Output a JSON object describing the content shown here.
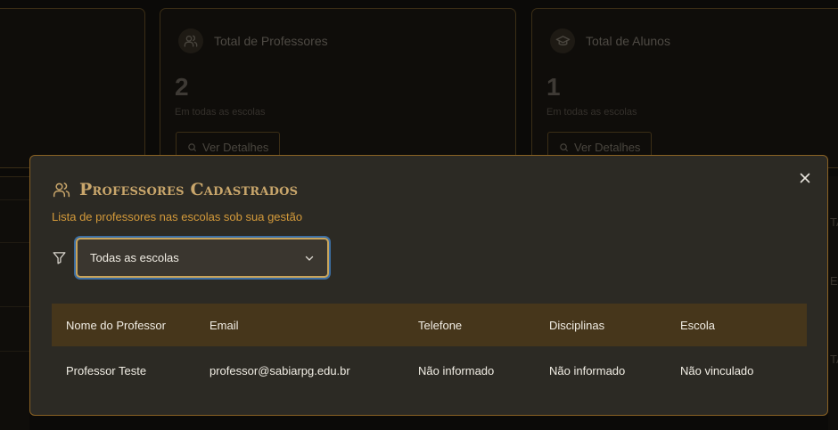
{
  "cards": {
    "professores": {
      "title": "Total de Professores",
      "value": "2",
      "subtitle": "Em todas as escolas",
      "button_label": "Ver Detalhes",
      "icon": "users-icon"
    },
    "alunos": {
      "title": "Total de Alunos",
      "value": "1",
      "subtitle": "Em todas as escolas",
      "button_label": "Ver Detalhes",
      "icon": "graduation-cap-icon"
    }
  },
  "background_peek": {
    "right_a": "TA",
    "right_b": "EV",
    "right_c": "TA"
  },
  "modal": {
    "title": "Professores Cadastrados",
    "description": "Lista de professores nas escolas sob sua gestão",
    "filter": {
      "selected": "Todas as escolas",
      "icon": "filter-icon"
    },
    "table": {
      "headers": [
        "Nome do Professor",
        "Email",
        "Telefone",
        "Disciplinas",
        "Escola"
      ],
      "rows": [
        [
          "Professor Teste",
          "professor@sabiarpg.edu.br",
          "Não informado",
          "Não informado",
          "Não vinculado"
        ]
      ]
    }
  },
  "colors": {
    "accent": "#c9a66b",
    "accent_orange": "#d49a3a",
    "modal_bg": "#2c2a24",
    "header_bg": "#46361b"
  }
}
